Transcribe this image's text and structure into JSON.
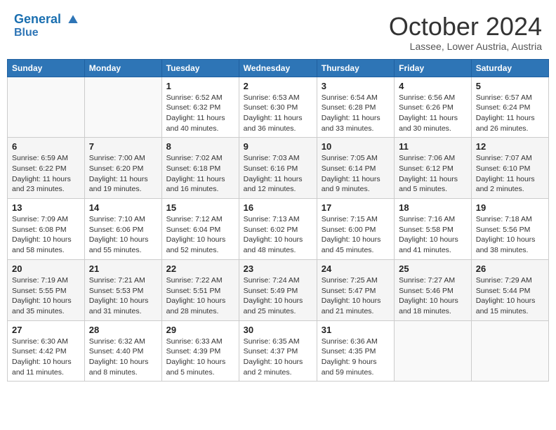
{
  "header": {
    "logo_line1": "General",
    "logo_line2": "Blue",
    "month": "October 2024",
    "location": "Lassee, Lower Austria, Austria"
  },
  "weekdays": [
    "Sunday",
    "Monday",
    "Tuesday",
    "Wednesday",
    "Thursday",
    "Friday",
    "Saturday"
  ],
  "weeks": [
    [
      {
        "day": "",
        "info": ""
      },
      {
        "day": "",
        "info": ""
      },
      {
        "day": "1",
        "info": "Sunrise: 6:52 AM\nSunset: 6:32 PM\nDaylight: 11 hours and 40 minutes."
      },
      {
        "day": "2",
        "info": "Sunrise: 6:53 AM\nSunset: 6:30 PM\nDaylight: 11 hours and 36 minutes."
      },
      {
        "day": "3",
        "info": "Sunrise: 6:54 AM\nSunset: 6:28 PM\nDaylight: 11 hours and 33 minutes."
      },
      {
        "day": "4",
        "info": "Sunrise: 6:56 AM\nSunset: 6:26 PM\nDaylight: 11 hours and 30 minutes."
      },
      {
        "day": "5",
        "info": "Sunrise: 6:57 AM\nSunset: 6:24 PM\nDaylight: 11 hours and 26 minutes."
      }
    ],
    [
      {
        "day": "6",
        "info": "Sunrise: 6:59 AM\nSunset: 6:22 PM\nDaylight: 11 hours and 23 minutes."
      },
      {
        "day": "7",
        "info": "Sunrise: 7:00 AM\nSunset: 6:20 PM\nDaylight: 11 hours and 19 minutes."
      },
      {
        "day": "8",
        "info": "Sunrise: 7:02 AM\nSunset: 6:18 PM\nDaylight: 11 hours and 16 minutes."
      },
      {
        "day": "9",
        "info": "Sunrise: 7:03 AM\nSunset: 6:16 PM\nDaylight: 11 hours and 12 minutes."
      },
      {
        "day": "10",
        "info": "Sunrise: 7:05 AM\nSunset: 6:14 PM\nDaylight: 11 hours and 9 minutes."
      },
      {
        "day": "11",
        "info": "Sunrise: 7:06 AM\nSunset: 6:12 PM\nDaylight: 11 hours and 5 minutes."
      },
      {
        "day": "12",
        "info": "Sunrise: 7:07 AM\nSunset: 6:10 PM\nDaylight: 11 hours and 2 minutes."
      }
    ],
    [
      {
        "day": "13",
        "info": "Sunrise: 7:09 AM\nSunset: 6:08 PM\nDaylight: 10 hours and 58 minutes."
      },
      {
        "day": "14",
        "info": "Sunrise: 7:10 AM\nSunset: 6:06 PM\nDaylight: 10 hours and 55 minutes."
      },
      {
        "day": "15",
        "info": "Sunrise: 7:12 AM\nSunset: 6:04 PM\nDaylight: 10 hours and 52 minutes."
      },
      {
        "day": "16",
        "info": "Sunrise: 7:13 AM\nSunset: 6:02 PM\nDaylight: 10 hours and 48 minutes."
      },
      {
        "day": "17",
        "info": "Sunrise: 7:15 AM\nSunset: 6:00 PM\nDaylight: 10 hours and 45 minutes."
      },
      {
        "day": "18",
        "info": "Sunrise: 7:16 AM\nSunset: 5:58 PM\nDaylight: 10 hours and 41 minutes."
      },
      {
        "day": "19",
        "info": "Sunrise: 7:18 AM\nSunset: 5:56 PM\nDaylight: 10 hours and 38 minutes."
      }
    ],
    [
      {
        "day": "20",
        "info": "Sunrise: 7:19 AM\nSunset: 5:55 PM\nDaylight: 10 hours and 35 minutes."
      },
      {
        "day": "21",
        "info": "Sunrise: 7:21 AM\nSunset: 5:53 PM\nDaylight: 10 hours and 31 minutes."
      },
      {
        "day": "22",
        "info": "Sunrise: 7:22 AM\nSunset: 5:51 PM\nDaylight: 10 hours and 28 minutes."
      },
      {
        "day": "23",
        "info": "Sunrise: 7:24 AM\nSunset: 5:49 PM\nDaylight: 10 hours and 25 minutes."
      },
      {
        "day": "24",
        "info": "Sunrise: 7:25 AM\nSunset: 5:47 PM\nDaylight: 10 hours and 21 minutes."
      },
      {
        "day": "25",
        "info": "Sunrise: 7:27 AM\nSunset: 5:46 PM\nDaylight: 10 hours and 18 minutes."
      },
      {
        "day": "26",
        "info": "Sunrise: 7:29 AM\nSunset: 5:44 PM\nDaylight: 10 hours and 15 minutes."
      }
    ],
    [
      {
        "day": "27",
        "info": "Sunrise: 6:30 AM\nSunset: 4:42 PM\nDaylight: 10 hours and 11 minutes."
      },
      {
        "day": "28",
        "info": "Sunrise: 6:32 AM\nSunset: 4:40 PM\nDaylight: 10 hours and 8 minutes."
      },
      {
        "day": "29",
        "info": "Sunrise: 6:33 AM\nSunset: 4:39 PM\nDaylight: 10 hours and 5 minutes."
      },
      {
        "day": "30",
        "info": "Sunrise: 6:35 AM\nSunset: 4:37 PM\nDaylight: 10 hours and 2 minutes."
      },
      {
        "day": "31",
        "info": "Sunrise: 6:36 AM\nSunset: 4:35 PM\nDaylight: 9 hours and 59 minutes."
      },
      {
        "day": "",
        "info": ""
      },
      {
        "day": "",
        "info": ""
      }
    ]
  ]
}
